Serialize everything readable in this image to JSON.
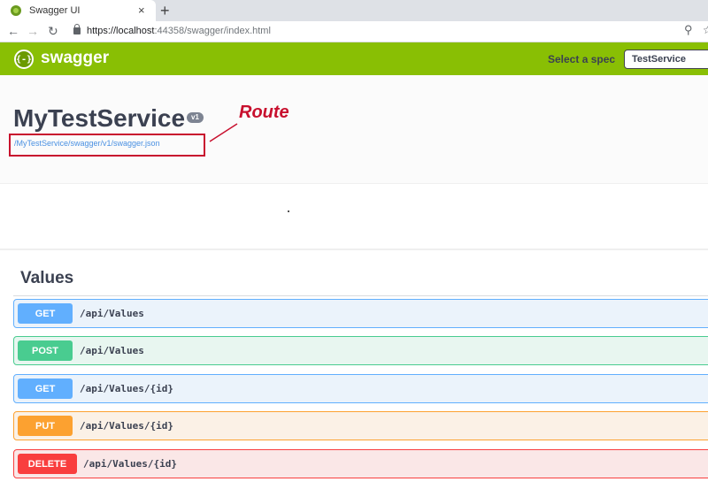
{
  "browser": {
    "tab_title": "Swagger UI",
    "tab_close": "×",
    "new_tab": "+",
    "url_host": "https://localhost",
    "url_rest": ":44358/swagger/index.html"
  },
  "topbar": {
    "brand": "swagger",
    "logo_glyph": "{-}",
    "spec_label": "Select a spec",
    "spec_value": "TestService"
  },
  "info": {
    "title": "MyTestService",
    "version": "v1",
    "spec_link": "/MyTestService/swagger/v1/swagger.json",
    "annotation": "Route",
    "annotation_color": "#c8102e"
  },
  "section": {
    "title": "Values",
    "operations": [
      {
        "method": "GET",
        "path": "/api/Values",
        "color": "#61affe"
      },
      {
        "method": "POST",
        "path": "/api/Values",
        "color": "#49cc90"
      },
      {
        "method": "GET",
        "path": "/api/Values/{id}",
        "color": "#61affe"
      },
      {
        "method": "PUT",
        "path": "/api/Values/{id}",
        "color": "#fca130"
      },
      {
        "method": "DELETE",
        "path": "/api/Values/{id}",
        "color": "#f93e3e"
      }
    ]
  },
  "colors": {
    "topbar": "#89bf04",
    "text": "#3b4151"
  }
}
